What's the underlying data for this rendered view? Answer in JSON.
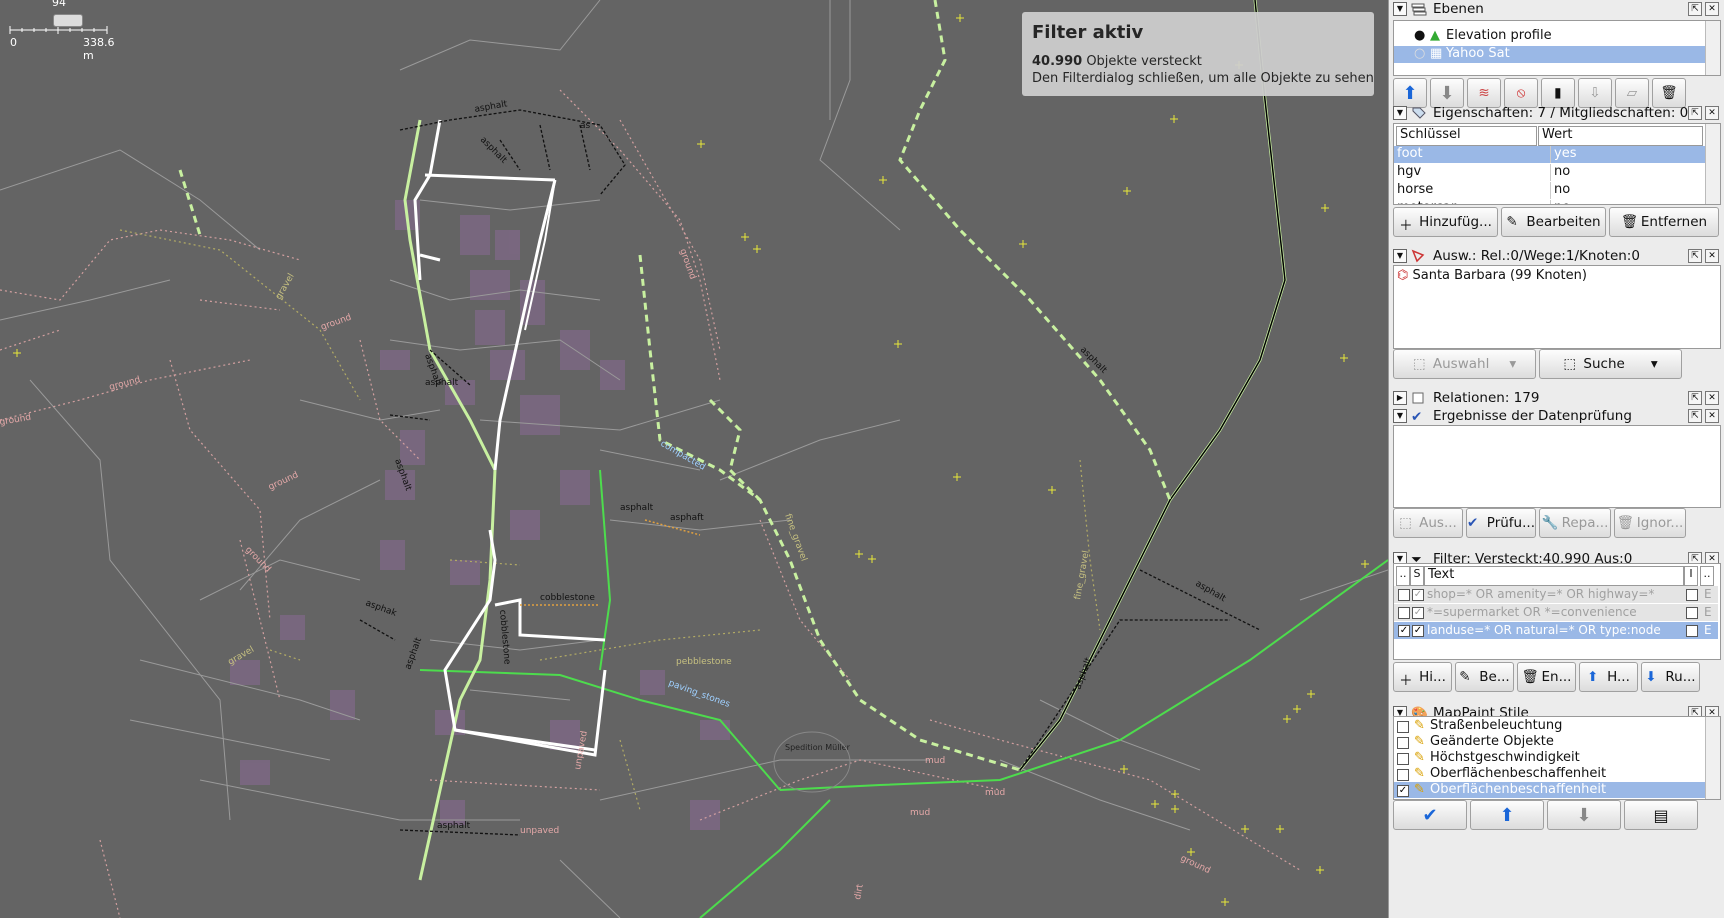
{
  "map": {
    "scale": {
      "zero": "0",
      "distance": "338.6 m",
      "zoom": "94"
    },
    "filter_notice": {
      "title": "Filter aktiv",
      "count": "40.990",
      "count_suffix": "Objekte versteckt",
      "hint": "Den Filterdialog schließen, um alle Objekte zu sehen"
    },
    "labels": {
      "asphalt": "asphalt",
      "ground": "ground",
      "gravel": "gravel",
      "compacted": "compacted",
      "fine_gravel": "fine_gravel",
      "cobblestone": "cobblestone",
      "pebblestone": "pebblestone",
      "paving_stones": "paving_stones",
      "unpaved": "unpaved",
      "mud": "mud",
      "dirt": "dirt",
      "spedition": "Spedition Müller",
      "as": "as",
      "asphak": "asphak",
      "asphaft": "asphaft",
      "aspha": "aspha"
    }
  },
  "layers": {
    "title": "Ebenen",
    "items": [
      {
        "name": "Elevation profile",
        "selected": false
      },
      {
        "name": "Yahoo Sat",
        "selected": true
      }
    ]
  },
  "properties": {
    "title": "Eigenschaften: 7 / Mitgliedschaften: 0",
    "col_key": "Schlüssel",
    "col_value": "Wert",
    "rows": [
      {
        "key": "foot",
        "value": "yes",
        "selected": true
      },
      {
        "key": "hgv",
        "value": "no"
      },
      {
        "key": "horse",
        "value": "no"
      },
      {
        "key": "motorcar",
        "value": "no"
      }
    ],
    "buttons": {
      "add": "Hinzufüg...",
      "edit": "Bearbeiten",
      "remove": "Entfernen"
    }
  },
  "selection": {
    "title": "Ausw.: Rel.:0/Wege:1/Knoten:0",
    "items": [
      "Santa Barbara (99 Knoten)"
    ],
    "buttons": {
      "select": "Auswahl",
      "search": "Suche"
    }
  },
  "relations": {
    "title": "Relationen: 179"
  },
  "validation": {
    "title": "Ergebnisse der Datenprüfung",
    "buttons": {
      "select": "Aus...",
      "check": "Prüfu...",
      "repair": "Repa...",
      "ignore": "Ignor..."
    }
  },
  "filter": {
    "title": "Filter: Versteckt:40.990 Aus:0",
    "col_text": "Text",
    "col_dots": "..",
    "col_s": "S",
    "col_i": "I",
    "col_dots2": "..",
    "rows": [
      {
        "text": "shop=* OR amenity=* OR highway=*",
        "enabled": false,
        "hide": true,
        "flag": "E",
        "selected": false
      },
      {
        "text": "*=supermarket OR *=convenience",
        "enabled": false,
        "hide": true,
        "flag": "E",
        "selected": false
      },
      {
        "text": "landuse=* OR natural=* OR type:node",
        "enabled": true,
        "hide": true,
        "flag": "E",
        "selected": true
      }
    ],
    "buttons": {
      "add": "Hi...",
      "edit": "Be...",
      "delete": "En...",
      "up": "H...",
      "down": "Ru..."
    }
  },
  "mappaint": {
    "title": "MapPaint Stile",
    "items": [
      {
        "name": "Straßenbeleuchtung",
        "checked": false
      },
      {
        "name": "Geänderte Objekte",
        "checked": false
      },
      {
        "name": "Höchstgeschwindigkeit",
        "checked": false
      },
      {
        "name": "Oberflächenbeschaffenheit",
        "checked": false
      },
      {
        "name": "Oberflächenbeschaffenheit",
        "checked": true,
        "selected": true
      }
    ]
  }
}
